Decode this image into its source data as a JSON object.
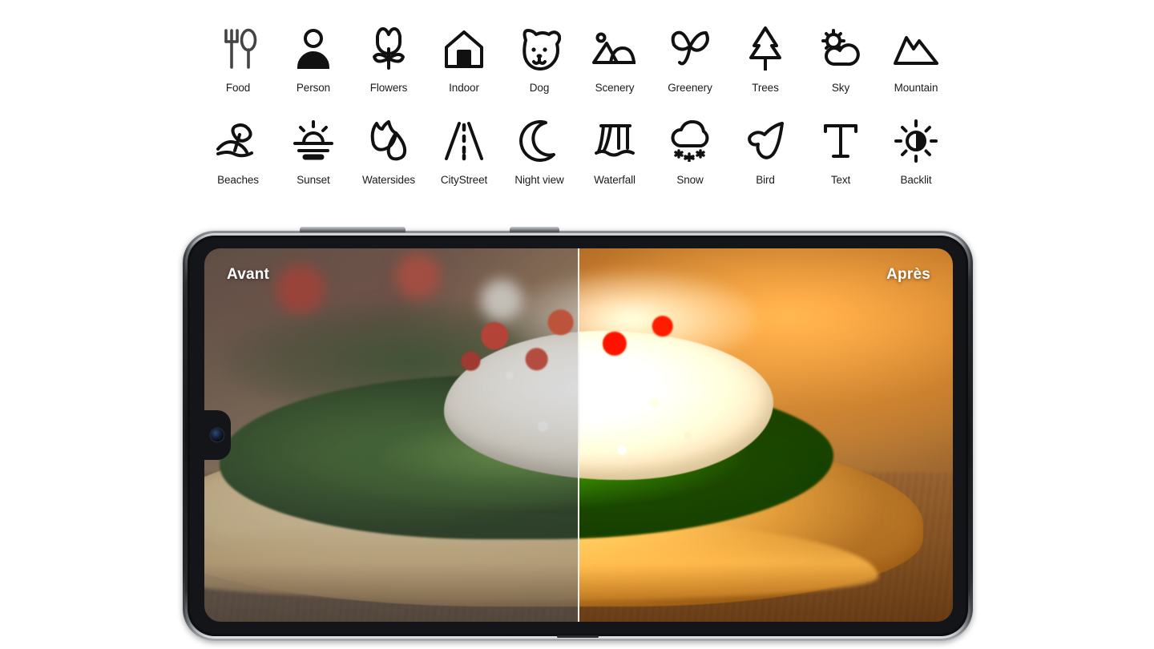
{
  "scene_optimizer": {
    "rows": [
      [
        {
          "label": "Food",
          "icon": "fork-spoon-icon"
        },
        {
          "label": "Person",
          "icon": "person-icon"
        },
        {
          "label": "Flowers",
          "icon": "tulip-icon"
        },
        {
          "label": "Indoor",
          "icon": "house-icon"
        },
        {
          "label": "Dog",
          "icon": "dog-icon"
        },
        {
          "label": "Scenery",
          "icon": "landscape-photo-icon"
        },
        {
          "label": "Greenery",
          "icon": "sprout-leaves-icon"
        },
        {
          "label": "Trees",
          "icon": "pine-tree-icon"
        },
        {
          "label": "Sky",
          "icon": "sun-cloud-icon"
        },
        {
          "label": "Mountain",
          "icon": "mountain-peaks-icon"
        }
      ],
      [
        {
          "label": "Beaches",
          "icon": "beach-umbrella-icon"
        },
        {
          "label": "Sunset",
          "icon": "sunset-icon"
        },
        {
          "label": "Watersides",
          "icon": "waterside-waves-icon"
        },
        {
          "label": "CityStreet",
          "icon": "road-icon"
        },
        {
          "label": "Night view",
          "icon": "crescent-moon-icon"
        },
        {
          "label": "Waterfall",
          "icon": "waterfall-icon"
        },
        {
          "label": "Snow",
          "icon": "cloud-snow-icon"
        },
        {
          "label": "Bird",
          "icon": "bird-icon"
        },
        {
          "label": "Text",
          "icon": "letter-t-icon"
        },
        {
          "label": "Backlit",
          "icon": "backlit-sun-icon"
        }
      ]
    ]
  },
  "phone_preview": {
    "caption_before": "Avant",
    "caption_after": "Après",
    "subject": "Flatbread with ricotta, spinach and tomato",
    "colors": {
      "icon": "#1b1b1b",
      "icon_muted": "#444444",
      "caption_text": "#ffffff",
      "split_line": "#f3f1ee",
      "page_background": "#ffffff",
      "phone_frame": "#1b1d20"
    }
  }
}
